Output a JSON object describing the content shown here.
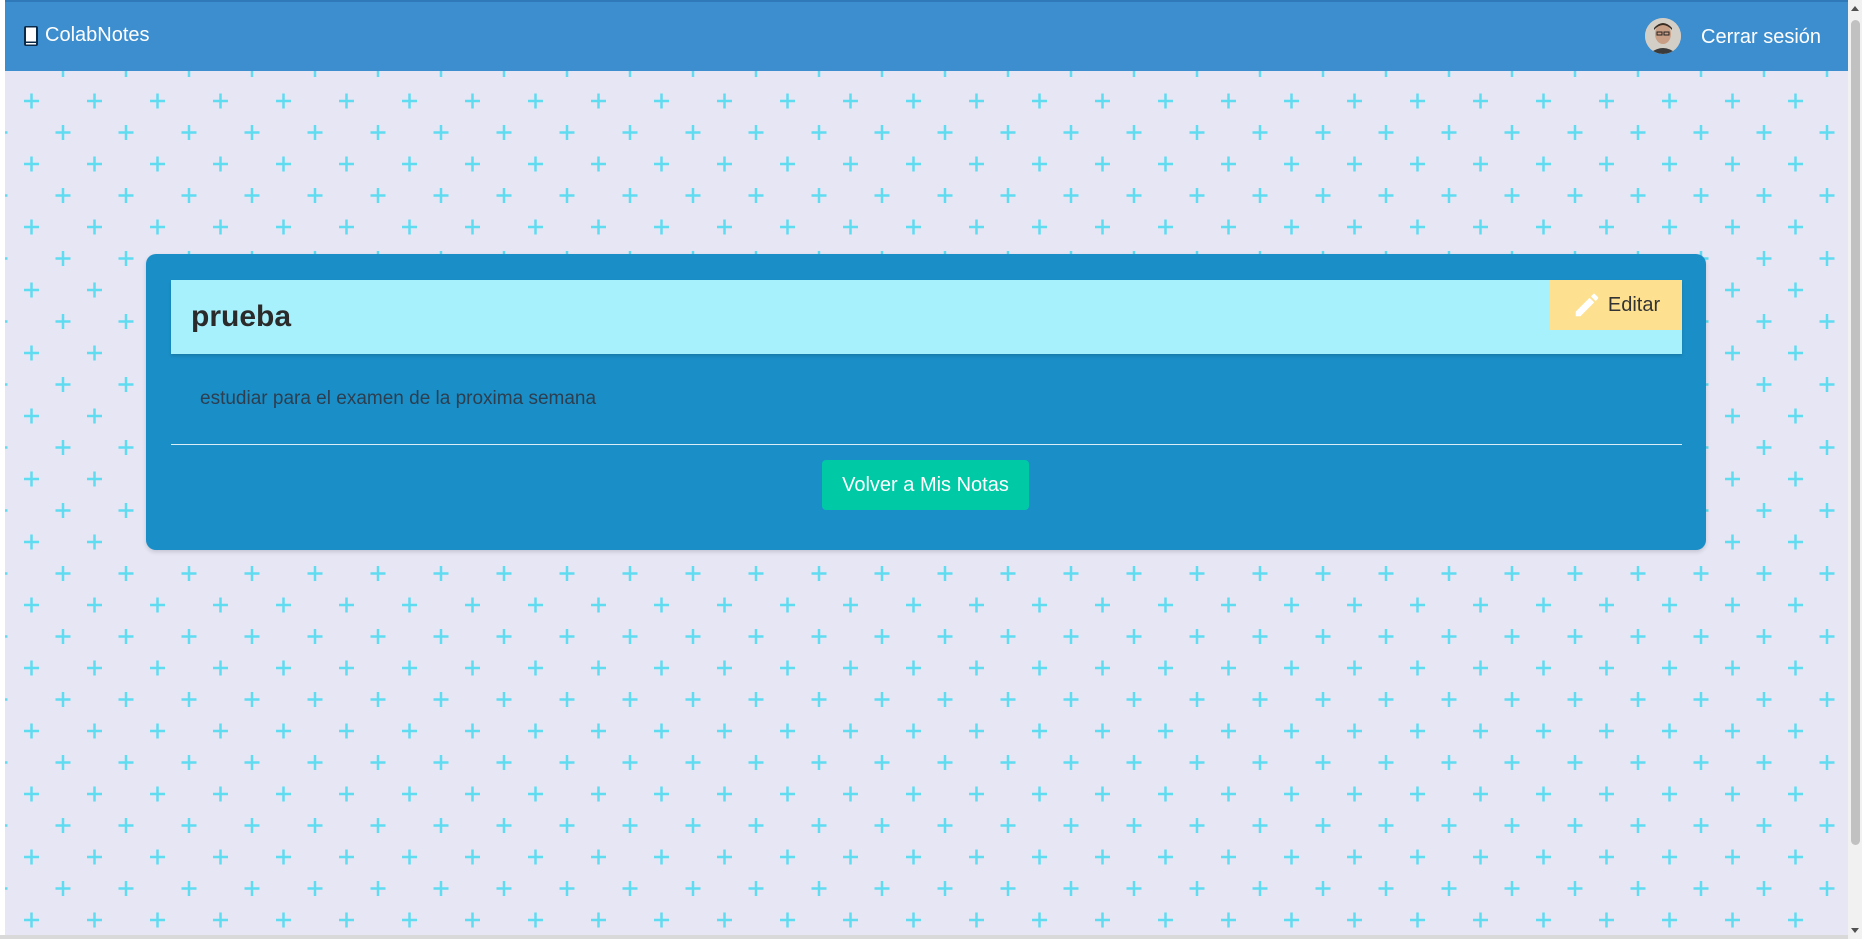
{
  "navbar": {
    "brand": "ColabNotes",
    "logout_label": "Cerrar sesión",
    "brand_icon": "book-icon",
    "background": "#3d8ecf"
  },
  "note": {
    "title": "prueba",
    "content": "estudiar para el examen de la proxima semana",
    "edit_label": "Editar",
    "edit_icon": "pencil-icon",
    "back_label": "Volver a Mis Notas"
  },
  "colors": {
    "page_bg": "#e6e6f5",
    "pattern": "#5fdcf0",
    "card": "#1a8fc7",
    "header": "#a7f1fc",
    "edit_button": "#fde191",
    "back_button": "#00c9a6"
  }
}
